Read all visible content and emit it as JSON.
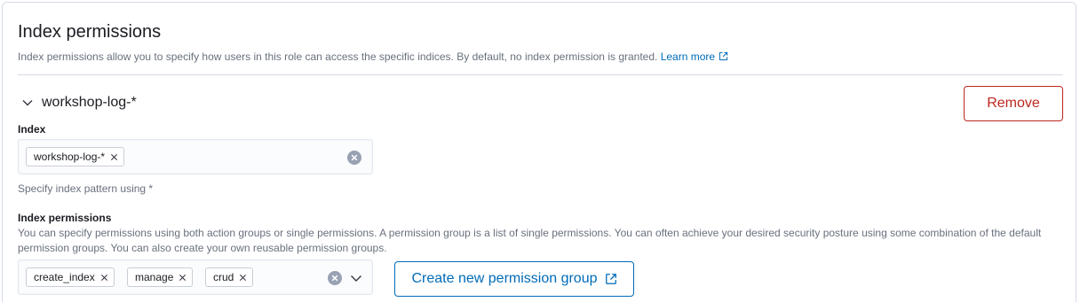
{
  "section": {
    "title": "Index permissions",
    "description": "Index permissions allow you to specify how users in this role can access the specific indices. By default, no index permission is granted.",
    "learn_more": "Learn more"
  },
  "accordion": {
    "label": "workshop-log-*",
    "remove_label": "Remove"
  },
  "index_field": {
    "label": "Index",
    "selected": [
      "workshop-log-*"
    ],
    "help": "Specify index pattern using *"
  },
  "permissions_field": {
    "label": "Index permissions",
    "help": "You can specify permissions using both action groups or single permissions. A permission group is a list of single permissions. You can often achieve your desired security posture using some combination of the default permission groups. You can also create your own reusable permission groups.",
    "selected": [
      "create_index",
      "manage",
      "crud"
    ],
    "create_button": "Create new permission group"
  },
  "colors": {
    "danger": "#bd271e",
    "primary": "#006bb8",
    "subdued_text": "#69707d"
  }
}
